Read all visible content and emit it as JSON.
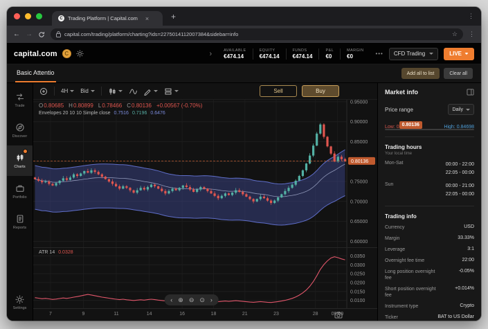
{
  "colors": {
    "accent": "#ef7d2f",
    "up": "#53b1a4",
    "down": "#e0564f",
    "band_fill": "rgba(67,78,160,0.42)",
    "band_edge": "#5f6ec9",
    "band_mid": "#8f97b8",
    "atr_line": "#e0566a",
    "badge": "#c05a2e",
    "low": "#d9584f",
    "high": "#4f9fd9"
  },
  "icons": {
    "back": "←",
    "forward": "→",
    "menu": "⋮",
    "star": "☆",
    "plus": "+",
    "close": "×",
    "collapse": "›",
    "nav_prev": "‹",
    "nav_next": "›",
    "zoom_in": "⊕",
    "zoom_out": "⊖",
    "reset": "⊙"
  },
  "browser": {
    "tab_title": "Trading Platform | Capital.com",
    "url": "capital.com/trading/platform/charting?ids=2275014112007384&sidebar=info"
  },
  "header": {
    "logo": "capital.com",
    "stats": [
      {
        "label": "AVAILABLE",
        "value": "€474.14"
      },
      {
        "label": "EQUITY",
        "value": "€474.14"
      },
      {
        "label": "FUNDS",
        "value": "€474.14"
      },
      {
        "label": "P&L",
        "value": "€0"
      },
      {
        "label": "MARGIN",
        "value": "€0"
      }
    ],
    "more": "•••",
    "account_mode": "CFD Trading",
    "live": "LIVE"
  },
  "watchlist": {
    "active_tab": "Basic Attentio",
    "add_all": "Add all to list",
    "clear_all": "Clear all"
  },
  "sidebar": {
    "items": [
      {
        "label": "Trade"
      },
      {
        "label": "Discover"
      },
      {
        "label": "Charts"
      },
      {
        "label": "Portfolio"
      },
      {
        "label": "Reports"
      }
    ],
    "settings": "Settings"
  },
  "toolbar": {
    "timeframe": "4H",
    "price_type": "Bid",
    "sell": "Sell",
    "buy": "Buy"
  },
  "legend": {
    "ohlc": [
      {
        "k": "O",
        "v": "0.80685"
      },
      {
        "k": "H",
        "v": "0.80899"
      },
      {
        "k": "L",
        "v": "0.78466"
      },
      {
        "k": "C",
        "v": "0.80136"
      }
    ],
    "change": "+0.00567 (-0.70%)",
    "envelopes_name": "Envelopes 20 10 10 Simple close",
    "envelopes_values": [
      "0.7516",
      "0.7196",
      "0.6476"
    ],
    "atr_name": "ATR 14",
    "atr_value": "0.0328"
  },
  "market_info": {
    "title": "Market info",
    "price_range_label": "Price range",
    "range_period": "Daily",
    "current_price": "0.80136",
    "low_label": "Low: 0.77678",
    "high_label": "High: 0.84698",
    "trading_hours_title": "Trading hours",
    "local_time_note": "Your local time",
    "hours": [
      {
        "days": "Mon-Sat",
        "times": [
          "00:00 - 22:00",
          "22:05 - 00:00"
        ]
      },
      {
        "days": "Sun",
        "times": [
          "00:00 - 21:00",
          "22:05 - 00:00"
        ]
      }
    ],
    "trading_info_title": "Trading info",
    "info": [
      {
        "label": "Currency",
        "value": "USD"
      },
      {
        "label": "Margin",
        "value": "33.33%"
      },
      {
        "label": "Leverage",
        "value": "3:1"
      },
      {
        "label": "Overnight fee time",
        "value": "22:00"
      },
      {
        "label": "Long position overnight fee",
        "value": "-0.05%"
      },
      {
        "label": "Short position overnight fee",
        "value": "+0.014%"
      },
      {
        "label": "Instrument type",
        "value": "Crypto"
      },
      {
        "label": "Ticker",
        "value": "BAT to US Dollar"
      }
    ]
  },
  "chart_data": {
    "type": "candlestick",
    "current_price": 0.80136,
    "y_range": [
      0.585,
      0.955
    ],
    "y_ticks": [
      0.6,
      0.65,
      0.7,
      0.75,
      0.8,
      0.85,
      0.9,
      0.95
    ],
    "closes": [
      0.756,
      0.752,
      0.748,
      0.75,
      0.744,
      0.74,
      0.746,
      0.752,
      0.758,
      0.754,
      0.76,
      0.768,
      0.764,
      0.77,
      0.776,
      0.772,
      0.778,
      0.774,
      0.768,
      0.762,
      0.756,
      0.75,
      0.744,
      0.738,
      0.732,
      0.738,
      0.734,
      0.728,
      0.722,
      0.728,
      0.734,
      0.73,
      0.736,
      0.742,
      0.738,
      0.732,
      0.726,
      0.72,
      0.726,
      0.732,
      0.728,
      0.734,
      0.74,
      0.736,
      0.73,
      0.724,
      0.73,
      0.736,
      0.732,
      0.726,
      0.72,
      0.714,
      0.708,
      0.714,
      0.72,
      0.716,
      0.722,
      0.728,
      0.724,
      0.718,
      0.712,
      0.706,
      0.7,
      0.706,
      0.712,
      0.708,
      0.702,
      0.696,
      0.702,
      0.71,
      0.718,
      0.726,
      0.734,
      0.742,
      0.752,
      0.764,
      0.778,
      0.795,
      0.815,
      0.84,
      0.87,
      0.893,
      0.862,
      0.838,
      0.82,
      0.8,
      0.812,
      0.806,
      0.801
    ],
    "envelope": {
      "period": 20,
      "upper_pct": 4.5,
      "lower_pct": 10
    },
    "atr": {
      "period": 14,
      "current": 0.0328,
      "range": [
        0.0075,
        0.0375
      ],
      "ticks": [
        0.01,
        0.015,
        0.02,
        0.025,
        0.03,
        0.035
      ],
      "values": [
        0.0115,
        0.0112,
        0.0109,
        0.0111,
        0.0108,
        0.0105,
        0.0107,
        0.011,
        0.0113,
        0.0111,
        0.0114,
        0.0118,
        0.0121,
        0.0125,
        0.0129,
        0.0133,
        0.013,
        0.0126,
        0.0122,
        0.0118,
        0.0115,
        0.0112,
        0.0109,
        0.0106,
        0.0104,
        0.0106,
        0.0103,
        0.0101,
        0.0099,
        0.0101,
        0.0103,
        0.0101,
        0.0104,
        0.0106,
        0.0104,
        0.0101,
        0.0099,
        0.0097,
        0.0099,
        0.0101,
        0.0099,
        0.0101,
        0.0103,
        0.0101,
        0.0099,
        0.0097,
        0.0099,
        0.0101,
        0.0099,
        0.0097,
        0.0096,
        0.0094,
        0.0092,
        0.0094,
        0.0096,
        0.0094,
        0.0096,
        0.0098,
        0.0096,
        0.0094,
        0.0092,
        0.009,
        0.0089,
        0.0091,
        0.0093,
        0.0091,
        0.0089,
        0.0088,
        0.009,
        0.0093,
        0.0096,
        0.01,
        0.0105,
        0.0111,
        0.0119,
        0.0129,
        0.0142,
        0.0158,
        0.0179,
        0.0205,
        0.0238,
        0.0274,
        0.0301,
        0.0322,
        0.0338,
        0.0345,
        0.034,
        0.0333,
        0.0328
      ]
    },
    "time_ticks": [
      {
        "label": "7",
        "f": 0.055
      },
      {
        "label": "9",
        "f": 0.16
      },
      {
        "label": "11",
        "f": 0.265
      },
      {
        "label": "14",
        "f": 0.37
      },
      {
        "label": "16",
        "f": 0.475
      },
      {
        "label": "18",
        "f": 0.575
      },
      {
        "label": "21",
        "f": 0.675
      },
      {
        "label": "23",
        "f": 0.775
      },
      {
        "label": "28",
        "f": 0.9
      },
      {
        "label": "09:00",
        "f": 0.97
      }
    ]
  }
}
